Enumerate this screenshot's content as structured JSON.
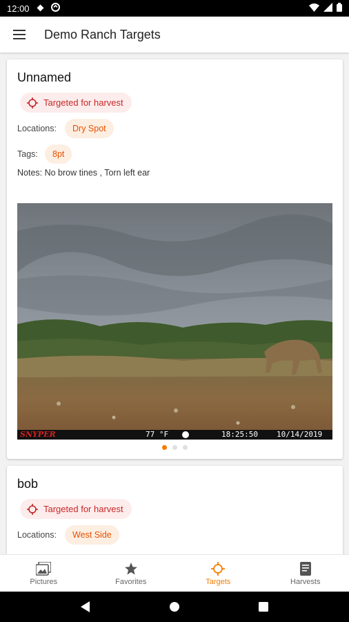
{
  "status": {
    "time": "12:00"
  },
  "appbar": {
    "title": "Demo Ranch Targets"
  },
  "colors": {
    "accent": "#f57c00",
    "harvest_red": "#c62828"
  },
  "targets": [
    {
      "name": "Unnamed",
      "status": "Targeted for harvest",
      "locations_label": "Locations:",
      "locations": [
        "Dry Spot"
      ],
      "tags_label": "Tags:",
      "tags": [
        "8pt"
      ],
      "notes": "Notes: No brow tines , Torn left ear",
      "photo": {
        "brand": "SNYPER",
        "temp": "77 °F",
        "time": "18:25:50",
        "date": "10/14/2019"
      },
      "carousel": {
        "count": 3,
        "active": 0
      }
    },
    {
      "name": "bob",
      "status": "Targeted for harvest",
      "locations_label": "Locations:",
      "locations": [
        "West Side"
      ]
    }
  ],
  "bottom_nav": [
    {
      "label": "Pictures",
      "icon": "pictures-icon",
      "active": false
    },
    {
      "label": "Favorites",
      "icon": "star-icon",
      "active": false
    },
    {
      "label": "Targets",
      "icon": "target-icon",
      "active": true
    },
    {
      "label": "Harvests",
      "icon": "harvests-icon",
      "active": false
    }
  ]
}
